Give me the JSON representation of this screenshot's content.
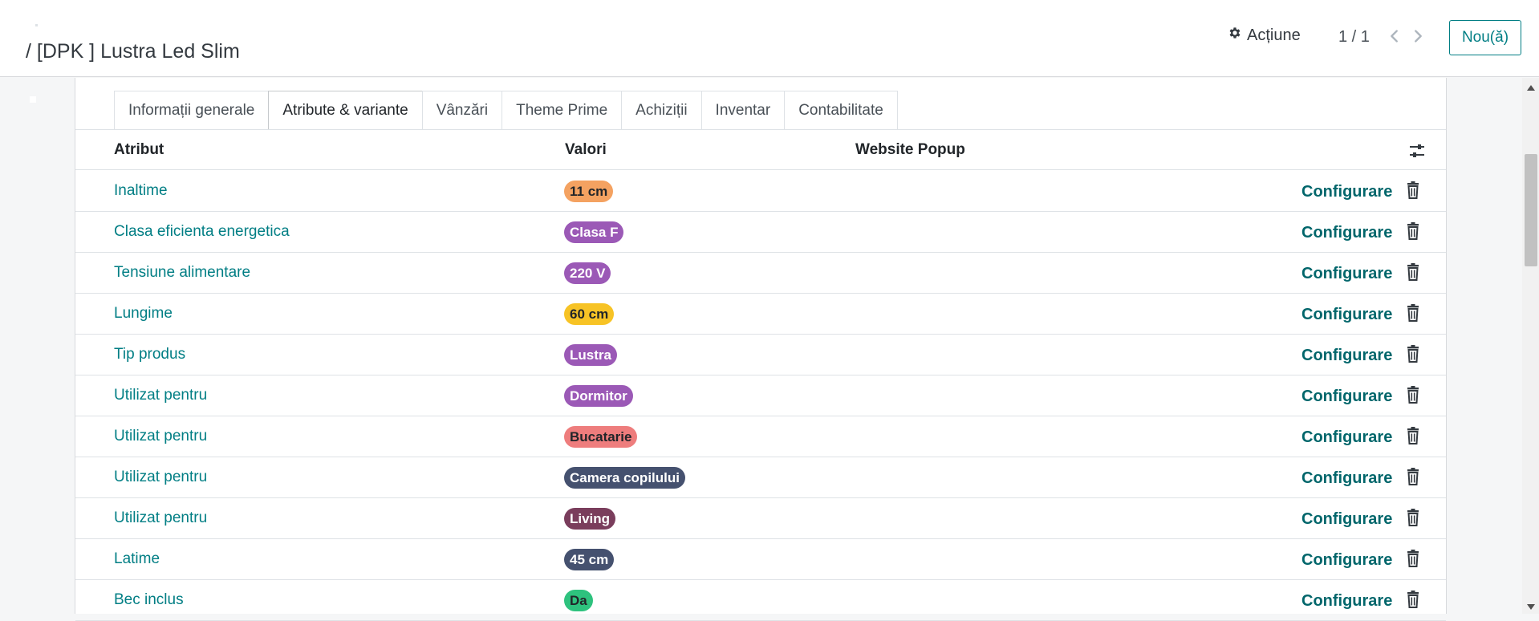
{
  "header": {
    "breadcrumb": "/ [DPK ] Lustra Led Slim",
    "action_label": "Acțiune",
    "pager": "1 / 1",
    "new_button": "Nou(ă)"
  },
  "tabs": [
    {
      "label": "Informații generale",
      "active": false
    },
    {
      "label": "Atribute & variante",
      "active": true
    },
    {
      "label": "Vânzări",
      "active": false
    },
    {
      "label": "Theme Prime",
      "active": false
    },
    {
      "label": "Achiziții",
      "active": false
    },
    {
      "label": "Inventar",
      "active": false
    },
    {
      "label": "Contabilitate",
      "active": false
    }
  ],
  "table": {
    "columns": {
      "attribute": "Atribut",
      "values": "Valori",
      "website_popup": "Website Popup"
    },
    "configure_label": "Configurare",
    "rows": [
      {
        "attribute": "Inaltime",
        "value": "11 cm",
        "color": "#f4a261",
        "text_color": "#212529"
      },
      {
        "attribute": "Clasa eficienta energetica",
        "value": "Clasa F",
        "color": "#9b59b6",
        "text_color": "#ffffff"
      },
      {
        "attribute": "Tensiune alimentare",
        "value": "220 V",
        "color": "#9b59b6",
        "text_color": "#ffffff"
      },
      {
        "attribute": "Lungime",
        "value": "60 cm",
        "color": "#f7c325",
        "text_color": "#212529"
      },
      {
        "attribute": "Tip produs",
        "value": "Lustra",
        "color": "#9b59b6",
        "text_color": "#ffffff"
      },
      {
        "attribute": "Utilizat pentru",
        "value": "Dormitor",
        "color": "#9b59b6",
        "text_color": "#ffffff"
      },
      {
        "attribute": "Utilizat pentru",
        "value": "Bucatarie",
        "color": "#ee7d7d",
        "text_color": "#212529"
      },
      {
        "attribute": "Utilizat pentru",
        "value": "Camera copilului",
        "color": "#45516f",
        "text_color": "#ffffff"
      },
      {
        "attribute": "Utilizat pentru",
        "value": "Living",
        "color": "#7a3d5c",
        "text_color": "#ffffff"
      },
      {
        "attribute": "Latime",
        "value": "45 cm",
        "color": "#45516f",
        "text_color": "#ffffff"
      },
      {
        "attribute": "Bec inclus",
        "value": "Da",
        "color": "#2ec27e",
        "text_color": "#212529"
      }
    ]
  }
}
